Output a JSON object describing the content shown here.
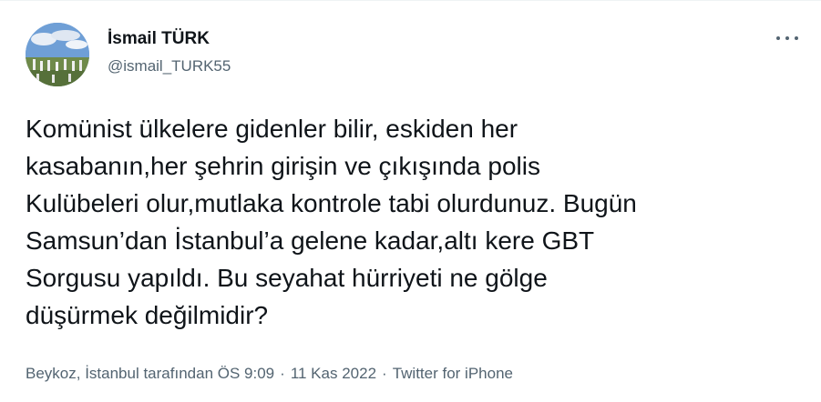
{
  "author": {
    "name": "İsmail TÜRK",
    "handle": "@ismail_TURK55"
  },
  "more_icon": "more-horizontal-icon",
  "tweet": {
    "text": "Komünist ülkelere gidenler bilir, eskiden her\nkasabanın,her şehrin girişin ve çıkışında polis\nKulübeleri olur,mutlaka kontrole tabi olurdunuz. Bugün\nSamsun’dan İstanbul’a gelene kadar,altı kere GBT\nSorgusu yapıldı. Bu seyahat hürriyeti ne gölge\ndüşürmek değilmidir?"
  },
  "meta": {
    "location": "Beykoz, İstanbul tarafından",
    "time": "ÖS 9:09",
    "separator": "·",
    "date": "11 Kas 2022",
    "source": "Twitter for iPhone"
  },
  "colors": {
    "text": "#0f1419",
    "secondary": "#536471"
  }
}
